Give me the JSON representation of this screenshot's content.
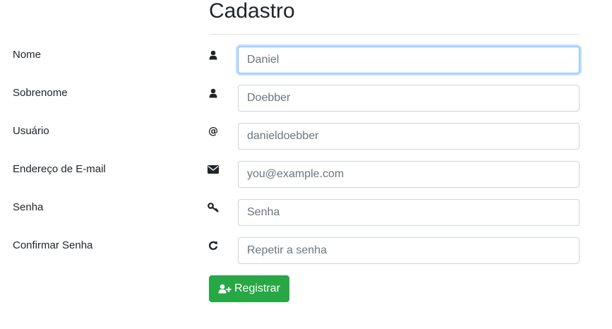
{
  "page": {
    "title": "Cadastro"
  },
  "form": {
    "fields": [
      {
        "label": "Nome",
        "icon": "user-icon",
        "value": "",
        "placeholder": "Daniel",
        "focused": true
      },
      {
        "label": "Sobrenome",
        "icon": "user-icon",
        "value": "",
        "placeholder": "Doebber"
      },
      {
        "label": "Usuário",
        "icon": "at-icon",
        "icon_glyph": "@",
        "value": "",
        "placeholder": "danieldoebber"
      },
      {
        "label": "Endereço de E-mail",
        "icon": "envelope-icon",
        "value": "",
        "placeholder": "you@example.com"
      },
      {
        "label": "Senha",
        "icon": "key-icon",
        "value": "",
        "placeholder": "Senha"
      },
      {
        "label": "Confirmar Senha",
        "icon": "refresh-icon",
        "value": "",
        "placeholder": "Repetir a senha"
      }
    ],
    "submit": {
      "label": "Registrar",
      "icon": "user-plus-icon",
      "color": "#28a745"
    }
  },
  "colors": {
    "focus_border": "#80bdff",
    "input_border": "#ced4da",
    "placeholder": "#6c757d"
  }
}
